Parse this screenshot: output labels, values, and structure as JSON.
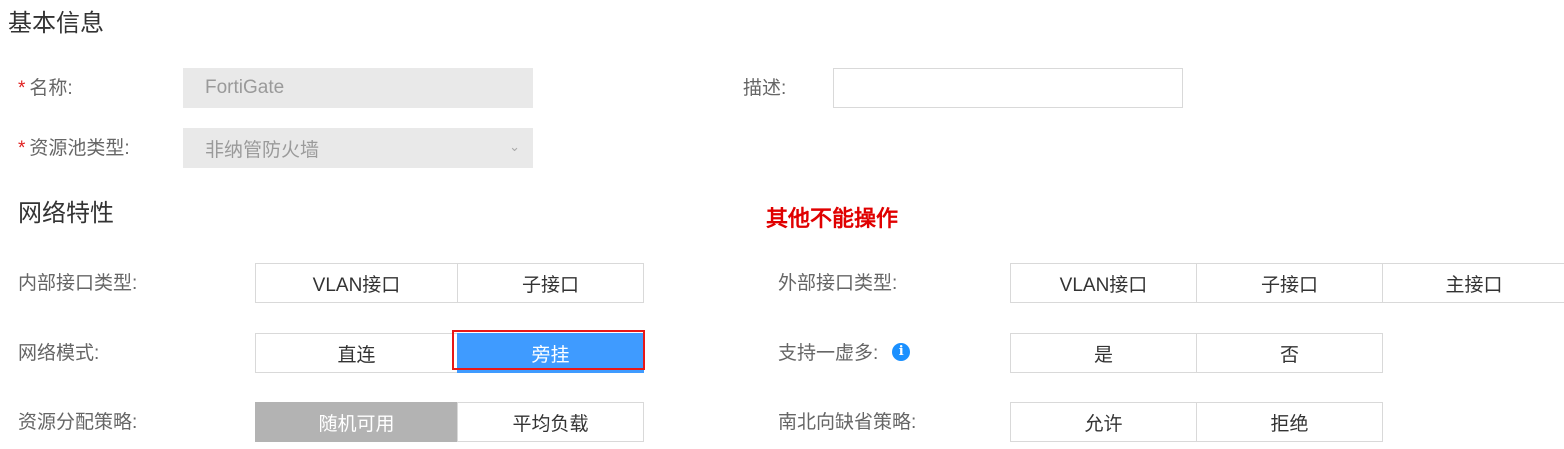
{
  "basic_info": {
    "title": "基本信息",
    "name_label": "名称:",
    "name_value": "FortiGate",
    "desc_label": "描述:",
    "desc_value": "",
    "pool_type_label": "资源池类型:",
    "pool_type_value": "非纳管防火墙",
    "required_mark": "*",
    "dropdown_icon": "chevron-down-icon"
  },
  "network": {
    "title": "网络特性",
    "note": "其他不能操作",
    "inner_interface": {
      "label": "内部接口类型:",
      "options": [
        "VLAN接口",
        "子接口"
      ]
    },
    "outer_interface": {
      "label": "外部接口类型:",
      "options": [
        "VLAN接口",
        "子接口",
        "主接口"
      ]
    },
    "network_mode": {
      "label": "网络模式:",
      "options": [
        "直连",
        "旁挂"
      ],
      "selected": "旁挂"
    },
    "multi_virtual": {
      "label": "支持一虚多:",
      "options": [
        "是",
        "否"
      ],
      "info_icon": "i"
    },
    "allocation": {
      "label": "资源分配策略:",
      "options": [
        "随机可用",
        "平均负载"
      ],
      "selected": "随机可用"
    },
    "north_south": {
      "label": "南北向缺省策略:",
      "options": [
        "允许",
        "拒绝"
      ]
    }
  },
  "colors": {
    "accent_blue": "#3f9bff",
    "selected_gray": "#b3b3b3",
    "note_red": "#e00000",
    "highlight_red": "#e81818"
  }
}
